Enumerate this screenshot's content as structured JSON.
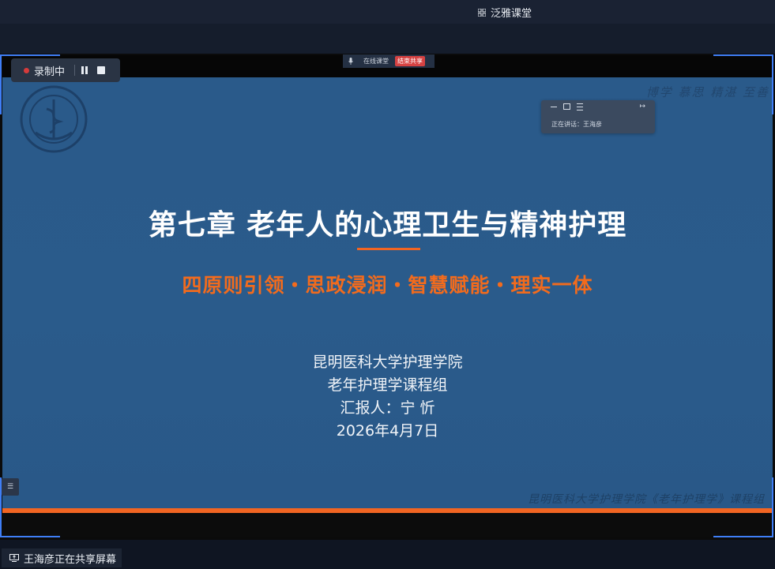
{
  "app": {
    "title": "泛雅课堂",
    "icon": "grid-icon"
  },
  "recording": {
    "label": "录制中",
    "pause_icon": "pause-icon",
    "stop_icon": "stop-icon"
  },
  "share_toolbar": {
    "label": "在线课堂",
    "end_label": "结束共享"
  },
  "speaking_panel": {
    "text": "正在讲话：王海彦"
  },
  "slide": {
    "chapter_title": "第七章 老年人的心理卫生与精神护理",
    "subtitle": "四原则引领・思政浸润・智慧赋能・理实一体",
    "info_lines": [
      "昆明医科大学护理学院",
      "老年护理学课程组",
      "汇报人：宁  忻",
      "2026年4月7日"
    ],
    "top_motto": "博学 慕思 精湛 至善",
    "footer_motto": "昆明医科大学护理学院《老年护理学》课程组",
    "colors": {
      "background": "#2a5a8a",
      "accent": "#f26522",
      "title": "#ffffff"
    }
  },
  "status_bar": {
    "sharing_text": "王海彦正在共享屏幕"
  }
}
